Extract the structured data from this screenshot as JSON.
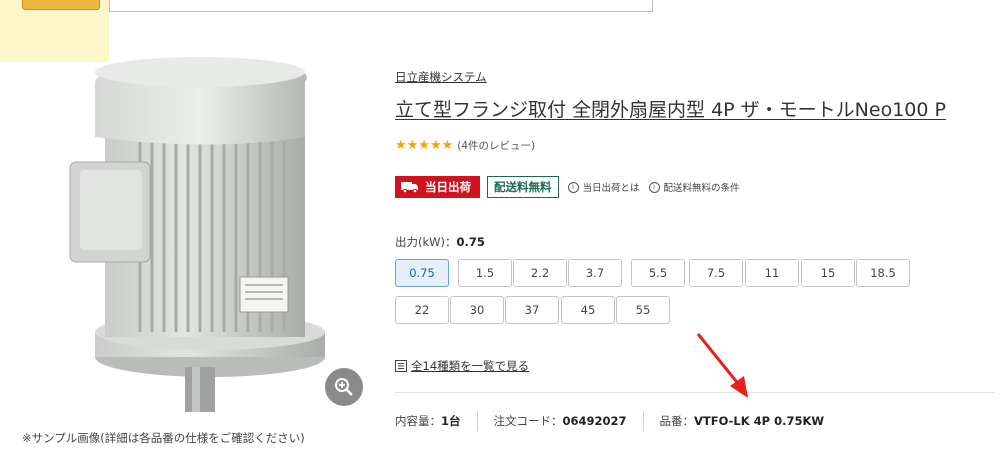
{
  "header": {
    "badge_label": ""
  },
  "product": {
    "maker": "日立産機システム",
    "title": "立て型フランジ取付 全閉外扇屋内型 4P ザ・モートルNeo100 P",
    "stars": "★★★★★",
    "review_text": "(4件のレビュー)",
    "image_note": "※サンプル画像(詳細は各品番の仕様をご確認ください)"
  },
  "badges": {
    "same_day": "当日出荷",
    "free_shipping": "配送料無料",
    "same_day_info": "当日出荷とは",
    "free_shipping_info": "配送料無料の条件"
  },
  "output": {
    "label": "出力(kW)：",
    "selected_value": "0.75",
    "options": [
      "0.75",
      "1.5",
      "2.2",
      "3.7",
      "5.5",
      "7.5",
      "11",
      "15",
      "18.5",
      "22",
      "30",
      "37",
      "45",
      "55"
    ]
  },
  "list_link": "全14種類を一覧で見る",
  "specs": {
    "quantity_label": "内容量：",
    "quantity_value": "1台",
    "order_code_label": "注文コード：",
    "order_code_value": "06492027",
    "part_number_label": "品番：",
    "part_number_value": "VTFO-LK 4P 0.75KW"
  },
  "colors": {
    "accent_red": "#d0131e",
    "accent_green": "#1a6c4f",
    "star_orange": "#f0a500",
    "selected_blue": "#e6f0fb",
    "annotation_arrow": "#e8201a"
  },
  "icons": {
    "zoom": "magnifier-plus-icon",
    "truck": "truck-icon",
    "info": "info-circle-icon",
    "list": "list-icon",
    "arrow": "annotation-arrow-icon"
  }
}
